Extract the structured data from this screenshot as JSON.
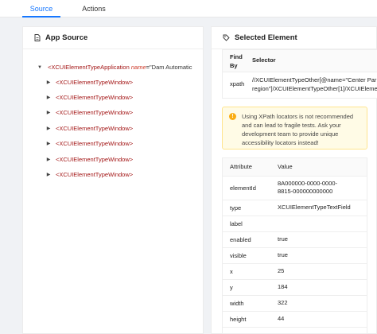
{
  "tabs": [
    {
      "label": "Source",
      "active": true
    },
    {
      "label": "Actions",
      "active": false
    }
  ],
  "app_source": {
    "title": "App Source",
    "icon": "file-icon",
    "root": {
      "tag": "<XCUIElementTypeApplication",
      "attr_name": "name",
      "attr_eq": "=",
      "attr_value": "\"Dam Automatic"
    },
    "children": [
      "<XCUIElementTypeWindow>",
      "<XCUIElementTypeWindow>",
      "<XCUIElementTypeWindow>",
      "<XCUIElementTypeWindow>",
      "<XCUIElementTypeWindow>",
      "<XCUIElementTypeWindow>",
      "<XCUIElementTypeWindow>"
    ]
  },
  "selected_element": {
    "title": "Selected Element",
    "icon": "tag-icon",
    "selector_table": {
      "headers": [
        "Find By",
        "Selector"
      ],
      "rows": [
        {
          "find_by": "xpath",
          "selector_line1": "//XCUIElementTypeOther[@name=\"Center Par",
          "selector_line2": "region\"]/XCUIElementTypeOther[1]/XCUIElementT"
        }
      ]
    },
    "warning": "Using XPath locators is not recommended and can lead to fragile tests. Ask your development team to provide unique accessibility locators instead!",
    "attributes": {
      "headers": [
        "Attribute",
        "Value"
      ],
      "rows": [
        {
          "attr": "elementId",
          "value_line1": "8A000000-0000-0000-",
          "value_line2": "8815-000000000000"
        },
        {
          "attr": "type",
          "value_line1": "XCUIElementTypeTextField",
          "value_line2": ""
        },
        {
          "attr": "label",
          "value_line1": "",
          "value_line2": ""
        },
        {
          "attr": "enabled",
          "value_line1": "true",
          "value_line2": ""
        },
        {
          "attr": "visible",
          "value_line1": "true",
          "value_line2": ""
        },
        {
          "attr": "x",
          "value_line1": "25",
          "value_line2": ""
        },
        {
          "attr": "y",
          "value_line1": "184",
          "value_line2": ""
        },
        {
          "attr": "width",
          "value_line1": "322",
          "value_line2": ""
        },
        {
          "attr": "height",
          "value_line1": "44",
          "value_line2": ""
        }
      ]
    }
  },
  "colors": {
    "accent": "#1677ff",
    "tag": "#a31515",
    "warning_bg": "#fffbe6",
    "warning_icon": "#faad14"
  }
}
